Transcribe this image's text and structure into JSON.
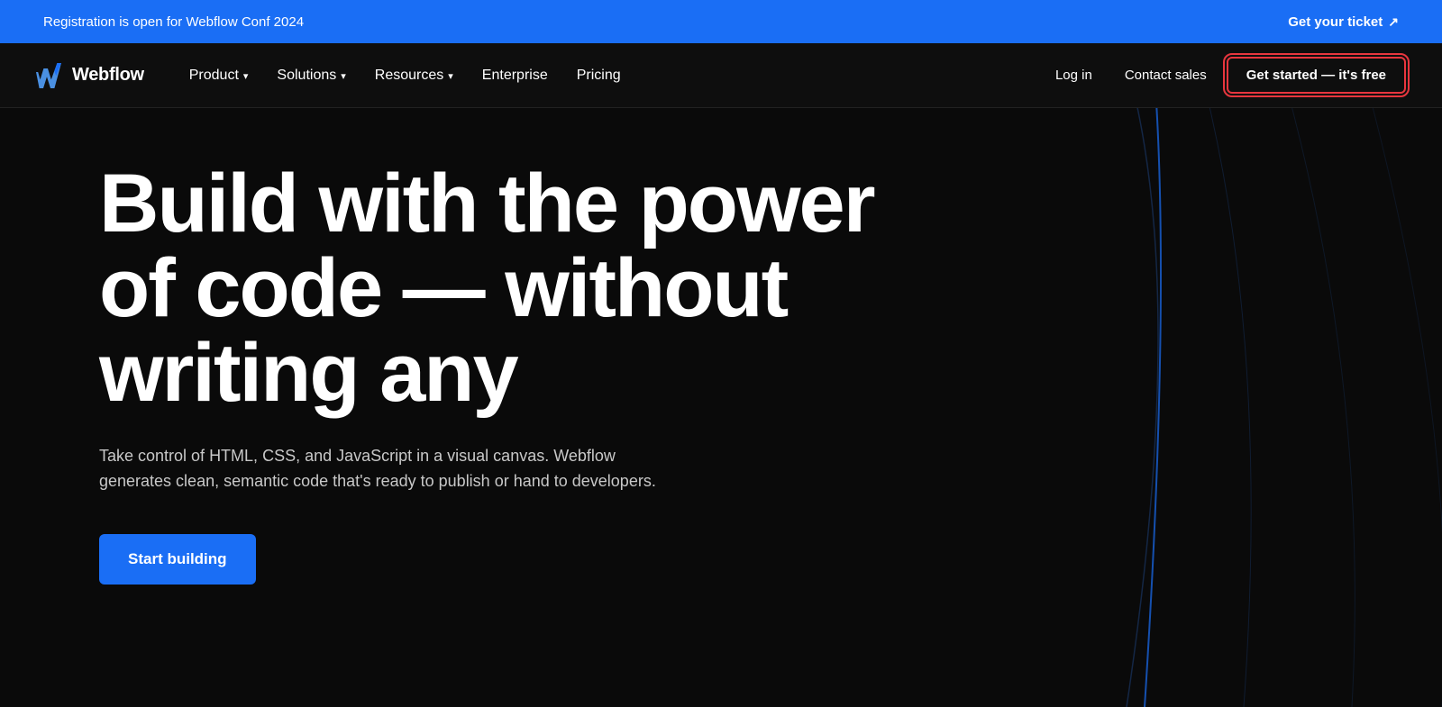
{
  "announcement": {
    "text": "Registration is open for Webflow Conf 2024",
    "link_label": "Get your ticket",
    "link_icon": "↗"
  },
  "nav": {
    "logo_text": "Webflow",
    "items": [
      {
        "label": "Product",
        "has_dropdown": true
      },
      {
        "label": "Solutions",
        "has_dropdown": true
      },
      {
        "label": "Resources",
        "has_dropdown": true
      },
      {
        "label": "Enterprise",
        "has_dropdown": false
      },
      {
        "label": "Pricing",
        "has_dropdown": false
      }
    ],
    "right": {
      "login": "Log in",
      "contact": "Contact sales",
      "cta": "Get started — it's free"
    }
  },
  "hero": {
    "title_line1": "Build with the power",
    "title_line2": "of code — without",
    "title_line3": "writing any",
    "subtitle": "Take control of HTML, CSS, and JavaScript in a visual canvas. Webflow generates clean, semantic code that's ready to publish or hand to developers.",
    "cta_label": "Start building"
  },
  "colors": {
    "announcement_bg": "#1a6ef5",
    "nav_bg": "#0e0e0e",
    "hero_bg": "#0a0a0a",
    "cta_border": "#e8363e",
    "cta_bg": "#1a6ef5"
  }
}
